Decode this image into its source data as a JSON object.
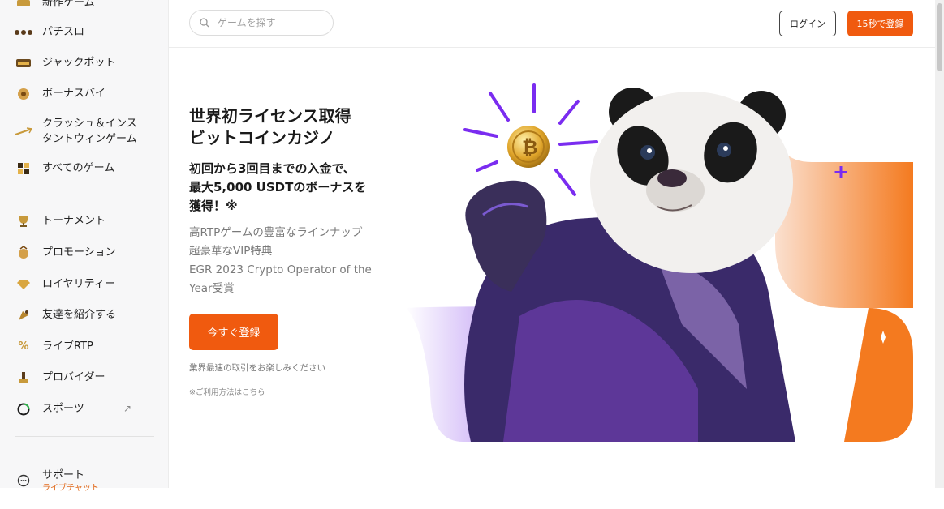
{
  "sidebar": {
    "items": [
      {
        "label": "新作ゲーム",
        "icon": "new-games-icon"
      },
      {
        "label": "パチスロ",
        "icon": "slot-icon"
      },
      {
        "label": "ジャックポット",
        "icon": "jackpot-icon"
      },
      {
        "label": "ボーナスバイ",
        "icon": "bonus-buy-icon"
      },
      {
        "label": "クラッシュ＆インス\nタントウィンゲーム",
        "icon": "crash-icon"
      },
      {
        "label": "すべてのゲーム",
        "icon": "all-games-icon"
      },
      {
        "label": "トーナメント",
        "icon": "trophy-icon"
      },
      {
        "label": "プロモーション",
        "icon": "promotion-icon"
      },
      {
        "label": "ロイヤリティー",
        "icon": "diamond-icon"
      },
      {
        "label": "友達を紹介する",
        "icon": "referral-icon"
      },
      {
        "label": "ライブRTP",
        "icon": "percent-icon"
      },
      {
        "label": "プロバイダー",
        "icon": "provider-icon"
      },
      {
        "label": "スポーツ",
        "icon": "sports-icon"
      }
    ],
    "support": {
      "label": "サポート",
      "sub": "ライブチャット"
    }
  },
  "header": {
    "search_placeholder": "ゲームを探す",
    "login_label": "ログイン",
    "register_label": "15秒で登録"
  },
  "hero": {
    "title": "世界初ライセンス取得\nビットコインカジノ",
    "subtitle": "初回から3回目までの入金で、\n最大5,000 USDTのボーナスを\n獲得！※",
    "features": [
      "高RTPゲームの豊富なラインナップ",
      "超豪華なVIP特典",
      "EGR 2023 Crypto Operator of the\nYear受賞"
    ],
    "cta_label": "今すぐ登録",
    "note": "業界最速の取引をお楽しみください",
    "terms_link": "※ご利用方法はこちら"
  },
  "colors": {
    "accent": "#f05a0f",
    "purple": "#7a2cf0",
    "sidebar_bg": "#f7f7f8"
  }
}
